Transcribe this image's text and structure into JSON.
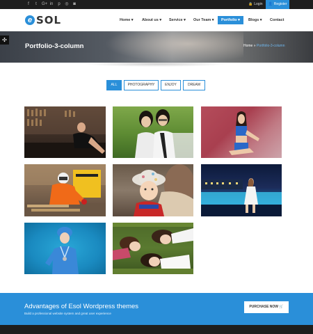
{
  "topbar": {
    "social_icons": [
      "facebook-icon",
      "twitter-icon",
      "google-plus-icon",
      "linkedin-icon",
      "pinterest-icon",
      "dribbble-icon",
      "instagram-icon"
    ],
    "social_glyphs": [
      "f",
      "t",
      "G+",
      "in",
      "p",
      "◎",
      "◙"
    ],
    "login_label": "Login",
    "register_label": "Register"
  },
  "header": {
    "logo_letter": "e",
    "logo_text": "SOL",
    "nav": [
      {
        "label": "Home ▾"
      },
      {
        "label": "About us ▾"
      },
      {
        "label": "Service ▾"
      },
      {
        "label": "Our Team ▾"
      },
      {
        "label": "Portfolio ▾"
      },
      {
        "label": "Blogs ▾"
      },
      {
        "label": "Contact"
      }
    ]
  },
  "banner": {
    "title": "Portfolio-3-column",
    "breadcrumb_home": "Home",
    "breadcrumb_sep": " » ",
    "breadcrumb_current": "Portfolio-3-column"
  },
  "filters": [
    {
      "label": "ALL"
    },
    {
      "label": "PHOTOGRAPHY"
    },
    {
      "label": "ENJOY"
    },
    {
      "label": "DREAM"
    }
  ],
  "gallery": [
    {
      "subject": "woman-in-black-dress-bar"
    },
    {
      "subject": "two-girls-on-grass"
    },
    {
      "subject": "woman-in-blue-outfit"
    },
    {
      "subject": "worker-in-orange-suit"
    },
    {
      "subject": "baby-in-hat"
    },
    {
      "subject": "woman-by-night-pool"
    },
    {
      "subject": "nurse-in-blue"
    },
    {
      "subject": "girls-lying-on-grass"
    }
  ],
  "cta": {
    "title": "Advantages of Esol Wordpress themes",
    "subtitle": "Build a professional website system and great user experience",
    "button_label": "PURCHASE NOW 🛒"
  },
  "colors": {
    "accent": "#2a8fd9",
    "topbar": "#1e1e1e"
  }
}
